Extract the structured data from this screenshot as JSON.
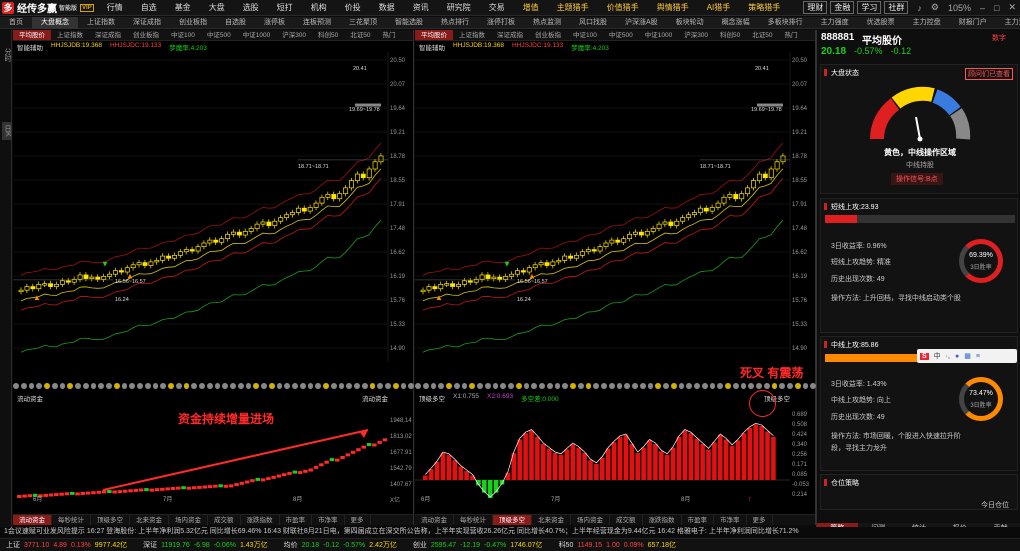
{
  "app": {
    "name": "经传多赢",
    "sub": "智能版",
    "badge": "VIP"
  },
  "menu": [
    "行情",
    "自选",
    "基金",
    "大盘",
    "选股",
    "短打",
    "机构",
    "价投",
    "数据",
    "资讯",
    "研究院",
    "交易",
    "增值",
    "主题猎手",
    "价值猎手",
    "舆情猎手",
    "AI猎手",
    "策略猎手"
  ],
  "menu_right": [
    "理财",
    "金融",
    "学习",
    "社群"
  ],
  "zoom": "105%",
  "tabs": [
    "首页",
    "大盘概念",
    "上证指数",
    "深证成指",
    "创业板指",
    "自选股",
    "涨停板",
    "连板预测",
    "三花聚顶",
    "智能选股",
    "热点排行",
    "涨停打板",
    "热点监测",
    "风口找股",
    "沪深涨A股",
    "板块轮动",
    "概念涨幅",
    "多板块排行",
    "主力强度",
    "优选股票",
    "主力控盘",
    "财报门户",
    "主力资金"
  ],
  "left_strip": [
    "分时",
    "日K"
  ],
  "chart_subtabs": [
    "平均股价",
    "上证指数",
    "深证成指",
    "创业板指",
    "中证100",
    "中证500",
    "中证1000",
    "沪深300",
    "科创50",
    "北证50",
    "热门"
  ],
  "indicators": {
    "l1": "智能辅助",
    "l2": "HHJSJDB:19.368",
    "l3": "HHJSJDC:19.133",
    "l4": "梦魔率:4.203"
  },
  "y_ticks": [
    "20.50",
    "20.07",
    "19.64",
    "19.21",
    "18.78",
    "18.55",
    "17.91",
    "17.48",
    "16.62",
    "16.19",
    "15.76",
    "15.33",
    "14.90"
  ],
  "price_labels": {
    "top": "20.41",
    "hi_range": "19.69~19.78",
    "mid": "18.71~18.71",
    "low": "16.56~16.57",
    "bottom": "16.24"
  },
  "left_sub": {
    "title": "流动资金",
    "right_label": "流动资金",
    "ticks": [
      "1948.14",
      "1813.02",
      "1677.91",
      "1542.79",
      "1407.67",
      "X亿"
    ],
    "months": [
      "6月",
      "7月",
      "8月"
    ],
    "annotation": "资金持续增量进场"
  },
  "right_sub": {
    "title": "顶级多空",
    "v1": "X1:0.755",
    "v2": "X2:0.693",
    "v3": "多空差:0.000",
    "right_label": "顶级多空",
    "ticks": [
      "0.689",
      "0.508",
      "0.424",
      "0.340",
      "0.256",
      "0.171",
      "0.085",
      "-0.053",
      "0.214"
    ],
    "months": [
      "6月",
      "7月",
      "8月"
    ],
    "annotation": "死叉 有震荡"
  },
  "bottom_tabs": [
    "流动资金",
    "每秒统计",
    "顶级多空",
    "北来资金",
    "场内资金",
    "成交额",
    "涨跌指数",
    "市盈率",
    "市净率",
    "更多"
  ],
  "stock": {
    "code": "888881",
    "name": "平均股价",
    "price": "20.18",
    "chg": "-0.57%",
    "chg2": "-0.12",
    "badge": "数字"
  },
  "market": {
    "title": "大盘状态",
    "link": "顾问们已查看",
    "gauge_text": "黄色，中线操作区域",
    "gauge_sub": "中线持股",
    "signal": "操作信号:B点"
  },
  "short": {
    "title": "短线上攻:23.93",
    "r1": "3日收益率: 0.96%",
    "r2": "短线上攻趋势: 精准",
    "r3": "历史出现次数: 49",
    "r4": "操作方法: 上升回档，寻找中线启动类个股",
    "pct": "69.39%",
    "ring_label": "3日胜率"
  },
  "mid": {
    "title": "中线上攻:85.86",
    "r1": "3日收益率: 1.43%",
    "r2": "中线上攻趋势: 向上",
    "r3": "历史出现次数: 49",
    "r4": "操作方法: 市场回暖，个股进入快速拉升阶段，寻找主力龙升",
    "pct": "73.47%",
    "ring_label": "3日胜率"
  },
  "sector": {
    "title": "仓位策略",
    "sub": "今日仓位",
    "pct": "80%"
  },
  "side_tabs": [
    "策略",
    "问测",
    "统计",
    "报价",
    "贡献"
  ],
  "ticker": "1会议速赋可业发风险提示    16:27 登海股份: 上半年净利润5.32亿元 同比增长69.46%    16:43 财联社8月21日电，第四届成立在深交所公告称，上半年实现营收26.26亿元 同比增长40.7%；上半年经营现金为9.44亿元    16:42 格雅电子: 上半年净利润同比增长71.2%",
  "status": [
    {
      "n": "上证",
      "v": "3771.10",
      "c": "4.89",
      "p": "0.13%",
      "a": "9977.42亿",
      "dir": "red"
    },
    {
      "n": "深证",
      "v": "11919.76",
      "c": "-6.98",
      "p": "-0.06%",
      "a": "1.43万亿",
      "dir": "green"
    },
    {
      "n": "均价",
      "v": "20.18",
      "c": "-0.12",
      "p": "-0.57%",
      "a": "2.42万亿",
      "dir": "green"
    },
    {
      "n": "创业",
      "v": "2595.47",
      "c": "-12.19",
      "p": "-0.47%",
      "a": "1746.07亿",
      "dir": "green"
    },
    {
      "n": "科50",
      "v": "1149.15",
      "c": "1.00",
      "p": "0.09%",
      "a": "657.18亿",
      "dir": "red"
    }
  ],
  "colors": {
    "up": "#ff3a3a",
    "down": "#19d119",
    "candle": "#ffe600",
    "accent": "#8a1b1b"
  }
}
